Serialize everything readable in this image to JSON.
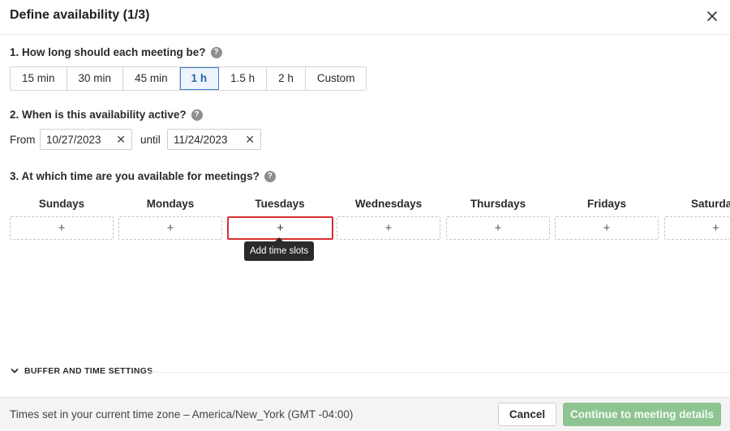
{
  "dialog": {
    "title": "Define availability (1/3)"
  },
  "duration": {
    "label": "1. How long should each meeting be?",
    "options": [
      "15 min",
      "30 min",
      "45 min",
      "1 h",
      "1.5 h",
      "2 h",
      "Custom"
    ],
    "selected": "1 h"
  },
  "active": {
    "label": "2. When is this availability active?",
    "from_label": "From",
    "from_value": "10/27/2023",
    "until_label": "until",
    "until_value": "11/24/2023"
  },
  "schedule": {
    "label": "3. At which time are you available for meetings?",
    "days": [
      "Sundays",
      "Mondays",
      "Tuesdays",
      "Wednesdays",
      "Thursdays",
      "Fridays",
      "Saturdays"
    ],
    "add_symbol": "+",
    "tooltip": "Add time slots"
  },
  "buffer": {
    "label": "BUFFER AND TIME SETTINGS"
  },
  "footer": {
    "timezone_note": "Times set in your current time zone – America/New_York (GMT -04:00)",
    "cancel_label": "Cancel",
    "continue_label": "Continue to meeting details"
  },
  "icons": {
    "help": "?",
    "clear": "✕"
  },
  "colors": {
    "accent_blue": "#3f7fd1",
    "highlight_red": "#d8302b",
    "continue_green": "#8ec491"
  }
}
